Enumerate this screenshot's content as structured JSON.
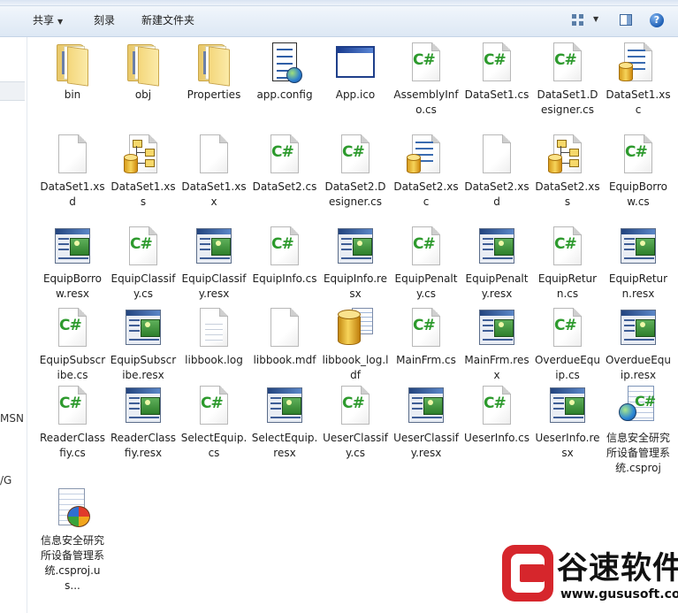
{
  "toolbar": {
    "share_label": "共享",
    "burn_label": "刻录",
    "new_folder_label": "新建文件夹",
    "help_label": "?"
  },
  "nav_pane": {
    "labels": [
      "MSN",
      "/G"
    ]
  },
  "files": [
    {
      "name": "bin",
      "type": "folder"
    },
    {
      "name": "obj",
      "type": "folder"
    },
    {
      "name": "Properties",
      "type": "folder"
    },
    {
      "name": "app.config",
      "type": "config"
    },
    {
      "name": "App.ico",
      "type": "ico"
    },
    {
      "name": "AssemblyInfo.cs",
      "type": "cs"
    },
    {
      "name": "DataSet1.cs",
      "type": "cs"
    },
    {
      "name": "DataSet1.Designer.cs",
      "type": "cs"
    },
    {
      "name": "DataSet1.xsc",
      "type": "xsc"
    },
    {
      "name": "DataSet1.xsd",
      "type": "blank"
    },
    {
      "name": "DataSet1.xss",
      "type": "xss"
    },
    {
      "name": "DataSet1.xsx",
      "type": "blank"
    },
    {
      "name": "DataSet2.cs",
      "type": "cs"
    },
    {
      "name": "DataSet2.Designer.cs",
      "type": "cs"
    },
    {
      "name": "DataSet2.xsc",
      "type": "xsc"
    },
    {
      "name": "DataSet2.xsd",
      "type": "blank"
    },
    {
      "name": "DataSet2.xss",
      "type": "xss"
    },
    {
      "name": "EquipBorrow.cs",
      "type": "cs"
    },
    {
      "name": "EquipBorrow.resx",
      "type": "resx"
    },
    {
      "name": "EquipClassify.cs",
      "type": "cs"
    },
    {
      "name": "EquipClassify.resx",
      "type": "resx"
    },
    {
      "name": "EquipInfo.cs",
      "type": "cs"
    },
    {
      "name": "EquipInfo.resx",
      "type": "resx"
    },
    {
      "name": "EquipPenalty.cs",
      "type": "cs"
    },
    {
      "name": "EquipPenalty.resx",
      "type": "resx"
    },
    {
      "name": "EquipReturn.cs",
      "type": "cs"
    },
    {
      "name": "EquipReturn.resx",
      "type": "resx"
    },
    {
      "name": "EquipSubscribe.cs",
      "type": "cs"
    },
    {
      "name": "EquipSubscribe.resx",
      "type": "resx"
    },
    {
      "name": "libbook.log",
      "type": "lines"
    },
    {
      "name": "libbook.mdf",
      "type": "blank"
    },
    {
      "name": "libbook_log.ldf",
      "type": "ldf"
    },
    {
      "name": "MainFrm.cs",
      "type": "cs"
    },
    {
      "name": "MainFrm.resx",
      "type": "resx"
    },
    {
      "name": "OverdueEquip.cs",
      "type": "cs"
    },
    {
      "name": "OverdueEquip.resx",
      "type": "resx"
    },
    {
      "name": "ReaderClassfiy.cs",
      "type": "cs"
    },
    {
      "name": "ReaderClassfiy.resx",
      "type": "resx"
    },
    {
      "name": "SelectEquip.cs",
      "type": "cs"
    },
    {
      "name": "SelectEquip.resx",
      "type": "resx"
    },
    {
      "name": "UeserClassify.cs",
      "type": "cs"
    },
    {
      "name": "UeserClassify.resx",
      "type": "resx"
    },
    {
      "name": "UeserInfo.cs",
      "type": "cs"
    },
    {
      "name": "UeserInfo.resx",
      "type": "resx"
    },
    {
      "name": "信息安全研究所设备管理系统.csproj",
      "type": "csproj"
    },
    {
      "name": "信息安全研究所设备管理系统.csproj.us...",
      "type": "csproj_user"
    }
  ],
  "watermark": {
    "name": "谷速软件",
    "url": "www.gususoft.com"
  },
  "colors": {
    "cs_green": "#2d9a2d",
    "watermark_red": "#d6262c",
    "toolbar_bg": "#eaf1f9"
  }
}
